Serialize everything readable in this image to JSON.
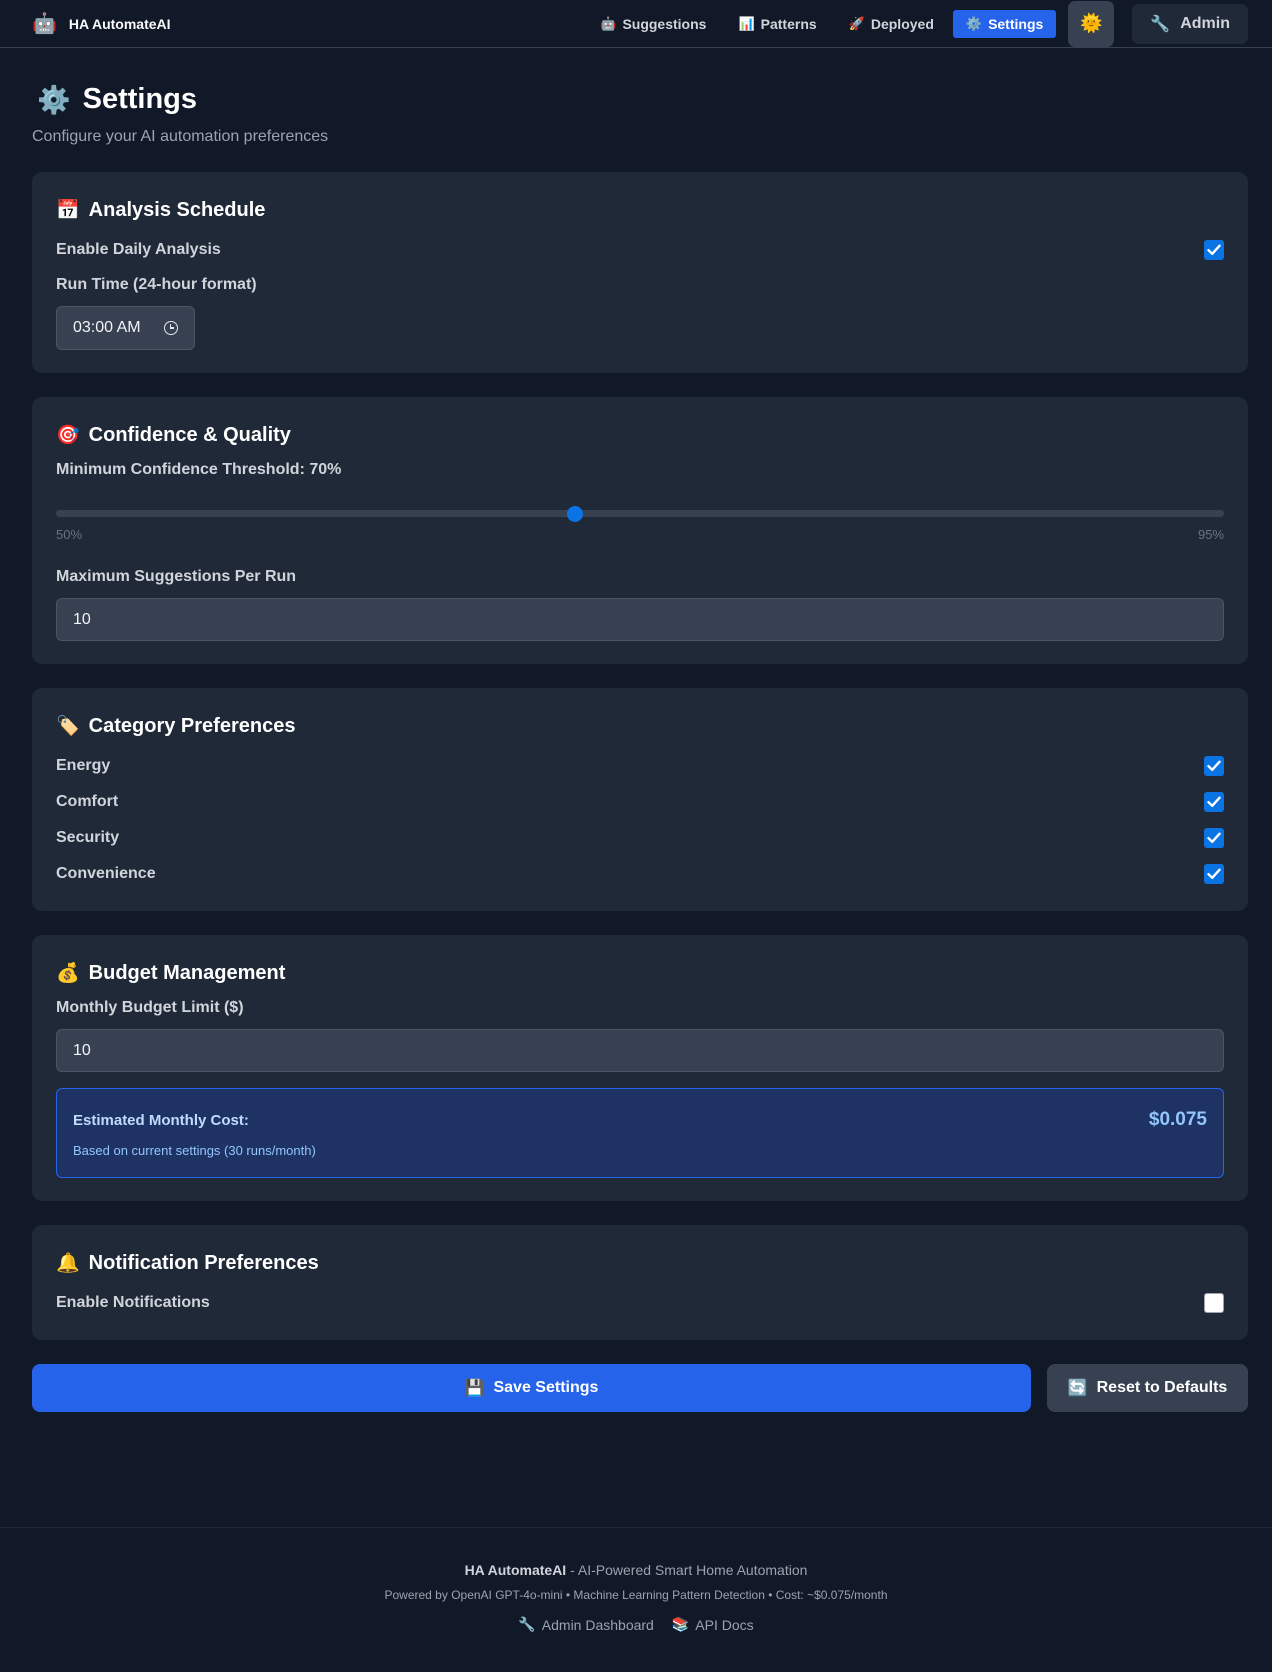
{
  "nav": {
    "brand_icon": "robot-icon",
    "brand_emoji": "🤖",
    "brand": "HA AutomateAI",
    "links": [
      {
        "icon": "robot-icon",
        "emoji": "🤖",
        "label": "Suggestions"
      },
      {
        "icon": "chart-icon",
        "emoji": "📊",
        "label": "Patterns"
      },
      {
        "icon": "rocket-icon",
        "emoji": "🚀",
        "label": "Deployed"
      },
      {
        "icon": "gear-icon",
        "emoji": "⚙️",
        "label": "Settings",
        "active": true
      }
    ],
    "theme_toggle_icon": "sun-icon",
    "theme_emoji": "🌞",
    "admin_icon": "wrench-icon",
    "admin_emoji": "🔧",
    "admin_label": "Admin"
  },
  "page": {
    "title_emoji": "⚙️",
    "title": "Settings",
    "subtitle": "Configure your AI automation preferences"
  },
  "schedule": {
    "emoji": "📅",
    "title": "Analysis Schedule",
    "enable_label": "Enable Daily Analysis",
    "enabled": true,
    "run_time_label": "Run Time (24-hour format)",
    "run_time_value": "03:00 AM"
  },
  "confidence": {
    "emoji": "🎯",
    "title": "Confidence & Quality",
    "threshold_label": "Minimum Confidence Threshold: 70%",
    "threshold_value": 70,
    "min_label": "50%",
    "max_label": "95%",
    "min": 50,
    "max": 95,
    "max_suggestions_label": "Maximum Suggestions Per Run",
    "max_suggestions_value": "10"
  },
  "categories": {
    "emoji": "🏷️",
    "title": "Category Preferences",
    "items": [
      {
        "label": "Energy",
        "checked": true
      },
      {
        "label": "Comfort",
        "checked": true
      },
      {
        "label": "Security",
        "checked": true
      },
      {
        "label": "Convenience",
        "checked": true
      }
    ]
  },
  "budget": {
    "emoji": "💰",
    "title": "Budget Management",
    "limit_label": "Monthly Budget Limit ($)",
    "limit_value": "10",
    "estimate_label": "Estimated Monthly Cost:",
    "estimate_value": "$0.075",
    "estimate_note": "Based on current settings (30 runs/month)"
  },
  "notifications": {
    "emoji": "🔔",
    "title": "Notification Preferences",
    "enable_label": "Enable Notifications",
    "enabled": false
  },
  "actions": {
    "save_emoji": "💾",
    "save_label": "Save Settings",
    "reset_emoji": "🔄",
    "reset_label": "Reset to Defaults"
  },
  "footer": {
    "brand": "HA AutomateAI",
    "tagline": " - AI-Powered Smart Home Automation",
    "powered": "Powered by OpenAI GPT-4o-mini • Machine Learning Pattern Detection • Cost: ~$0.075/month",
    "admin_emoji": "🔧",
    "admin_link": "Admin Dashboard",
    "api_emoji": "📚",
    "api_link": "API Docs"
  },
  "colors": {
    "accent": "#2563eb",
    "checkbox": "#0b74e5",
    "background": "#111827",
    "card": "#1f2937"
  }
}
